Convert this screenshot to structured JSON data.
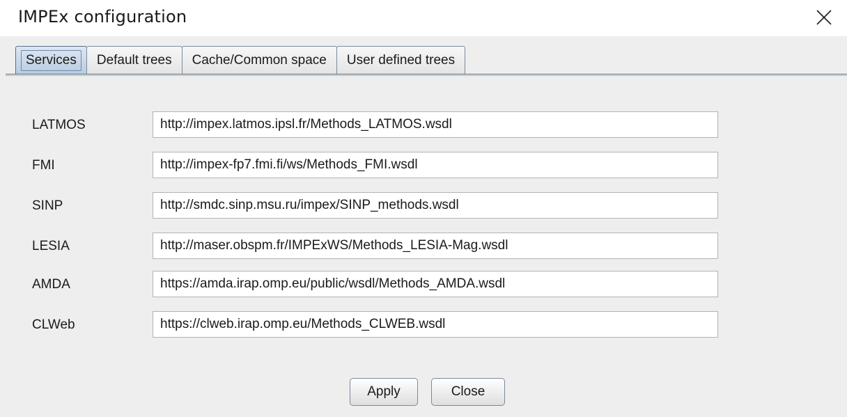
{
  "window": {
    "title": "IMPEx configuration",
    "close_icon": "close-x-icon"
  },
  "tabs": [
    {
      "label": "Services",
      "active": true
    },
    {
      "label": "Default trees",
      "active": false
    },
    {
      "label": "Cache/Common space",
      "active": false
    },
    {
      "label": "User defined trees",
      "active": false
    }
  ],
  "services": [
    {
      "label": "LATMOS",
      "value": "http://impex.latmos.ipsl.fr/Methods_LATMOS.wsdl"
    },
    {
      "label": "FMI",
      "value": "http://impex-fp7.fmi.fi/ws/Methods_FMI.wsdl"
    },
    {
      "label": "SINP",
      "value": "http://smdc.sinp.msu.ru/impex/SINP_methods.wsdl"
    },
    {
      "label": "LESIA",
      "value": "http://maser.obspm.fr/IMPExWS/Methods_LESIA-Mag.wsdl"
    },
    {
      "label": "AMDA",
      "value": "https://amda.irap.omp.eu/public/wsdl/Methods_AMDA.wsdl"
    },
    {
      "label": "CLWeb",
      "value": "https://clweb.irap.omp.eu/Methods_CLWEB.wsdl"
    }
  ],
  "buttons": {
    "apply": "Apply",
    "close": "Close"
  },
  "colors": {
    "background": "#eeeeee",
    "active_tab": "#b8cbe0",
    "border": "#7a8a9c"
  }
}
